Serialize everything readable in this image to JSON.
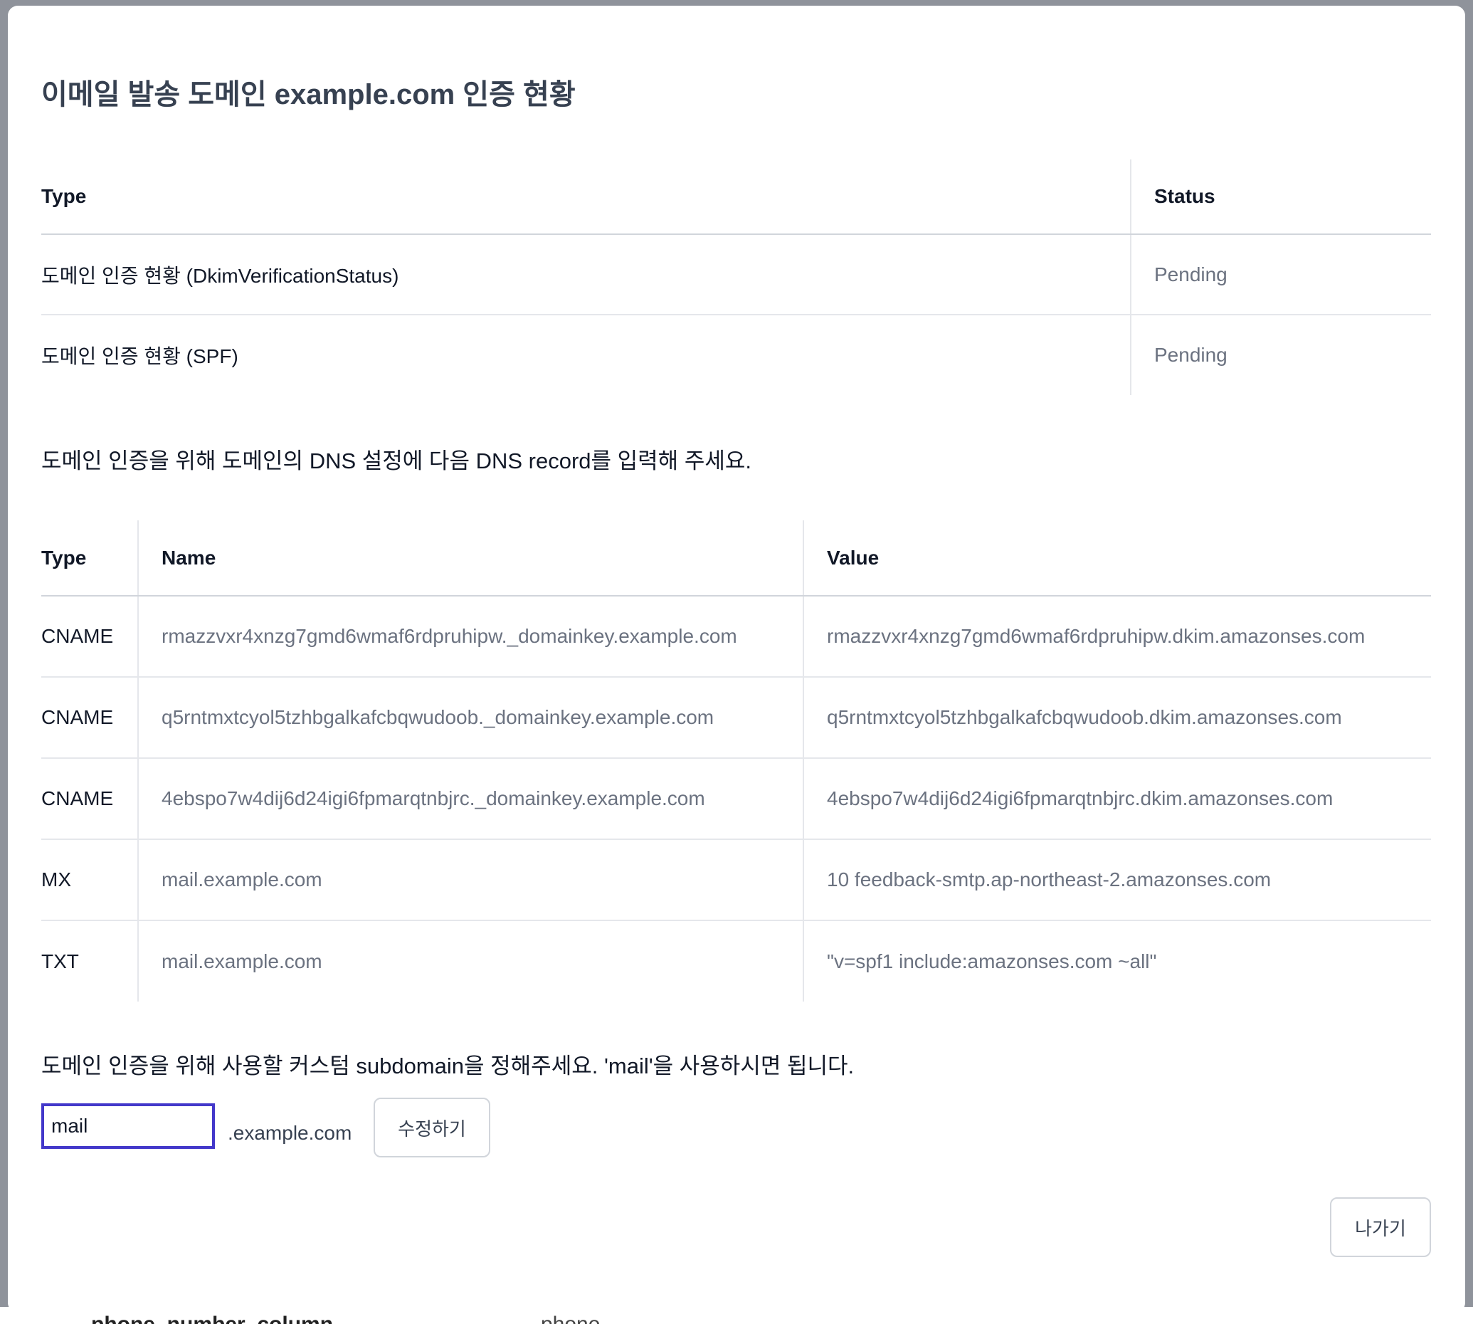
{
  "background_page": {
    "column_label": "phone_number_column",
    "edit_hint": "phone"
  },
  "modal": {
    "title": "이메일 발송 도메인 example.com 인증 현황",
    "status_table": {
      "headers": [
        "Type",
        "Status"
      ],
      "rows": [
        {
          "type": "도메인 인증 현황 (DkimVerificationStatus)",
          "status": "Pending"
        },
        {
          "type": "도메인 인증 현황 (SPF)",
          "status": "Pending"
        }
      ]
    },
    "dns_instruction": "도메인 인증을 위해 도메인의 DNS 설정에 다음 DNS record를 입력해 주세요.",
    "dns_table": {
      "headers": [
        "Type",
        "Name",
        "Value"
      ],
      "rows": [
        {
          "type": "CNAME",
          "name": "rmazzvxr4xnzg7gmd6wmaf6rdpruhipw._domainkey.example.com",
          "value": "rmazzvxr4xnzg7gmd6wmaf6rdpruhipw.dkim.amazonses.com"
        },
        {
          "type": "CNAME",
          "name": "q5rntmxtcyol5tzhbgalkafcbqwudoob._domainkey.example.com",
          "value": "q5rntmxtcyol5tzhbgalkafcbqwudoob.dkim.amazonses.com"
        },
        {
          "type": "CNAME",
          "name": "4ebspo7w4dij6d24igi6fpmarqtnbjrc._domainkey.example.com",
          "value": "4ebspo7w4dij6d24igi6fpmarqtnbjrc.dkim.amazonses.com"
        },
        {
          "type": "MX",
          "name": "mail.example.com",
          "value": "10 feedback-smtp.ap-northeast-2.amazonses.com"
        },
        {
          "type": "TXT",
          "name": "mail.example.com",
          "value": "\"v=spf1 include:amazonses.com ~all\""
        }
      ]
    },
    "subdomain_instruction": "도메인 인증을 위해 사용할 커스텀 subdomain을 정해주세요. 'mail'을 사용하시면 됩니다.",
    "subdomain_value": "mail",
    "domain_suffix": ".example.com",
    "modify_button": "수정하기",
    "exit_button": "나가기"
  }
}
